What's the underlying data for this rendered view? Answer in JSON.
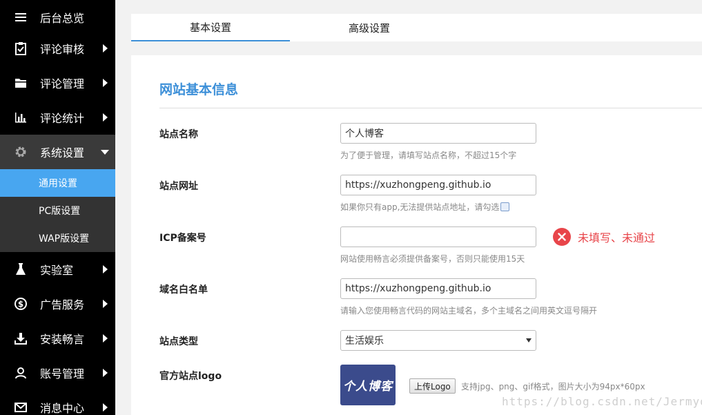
{
  "sidebar": {
    "items": [
      {
        "label": "后台总览",
        "icon": "menu-icon"
      },
      {
        "label": "评论审核",
        "icon": "checklist-icon"
      },
      {
        "label": "评论管理",
        "icon": "folder-icon"
      },
      {
        "label": "评论统计",
        "icon": "bar-chart-icon"
      },
      {
        "label": "系统设置",
        "icon": "gear-icon"
      },
      {
        "label": "实验室",
        "icon": "flask-icon"
      },
      {
        "label": "广告服务",
        "icon": "dollar-icon"
      },
      {
        "label": "安装畅言",
        "icon": "download-icon"
      },
      {
        "label": "账号管理",
        "icon": "user-icon"
      },
      {
        "label": "消息中心",
        "icon": "mail-icon"
      }
    ],
    "sub_items": [
      {
        "label": "通用设置"
      },
      {
        "label": "PC版设置"
      },
      {
        "label": "WAP版设置"
      }
    ]
  },
  "tabs": [
    {
      "label": "基本设置"
    },
    {
      "label": "高级设置"
    }
  ],
  "section": {
    "title": "网站基本信息"
  },
  "form": {
    "site_name": {
      "label": "站点名称",
      "value": "个人博客",
      "hint": "为了便于管理，请填写站点名称，不超过15个字"
    },
    "site_url": {
      "label": "站点网址",
      "value": "https://xuzhongpeng.github.io",
      "hint": "如果你只有app,无法提供站点地址，请勾选"
    },
    "icp": {
      "label": "ICP备案号",
      "value": "",
      "hint": "网站使用畅言必须提供备案号，否则只能使用15天",
      "error": "未填写、未通过"
    },
    "whitelist": {
      "label": "域名白名单",
      "value": "https://xuzhongpeng.github.io",
      "hint": "请输入您使用畅言代码的网站主域名，多个主域名之间用英文逗号隔开"
    },
    "site_type": {
      "label": "站点类型",
      "value": "生活娱乐"
    },
    "logo": {
      "label": "官方站点logo",
      "logo_text": "个人博客",
      "upload_label": "上传Logo",
      "hint": "支持jpg、png、gif格式，图片大小为94px*60px"
    }
  },
  "watermark": "https://blog.csdn.net/Jermyo",
  "colors": {
    "sidebar_bg": "#000000",
    "active_sub": "#48a6f0",
    "accent": "#3c8fd8",
    "error": "#e8454a",
    "logo_bg": "#3b4b8c"
  }
}
